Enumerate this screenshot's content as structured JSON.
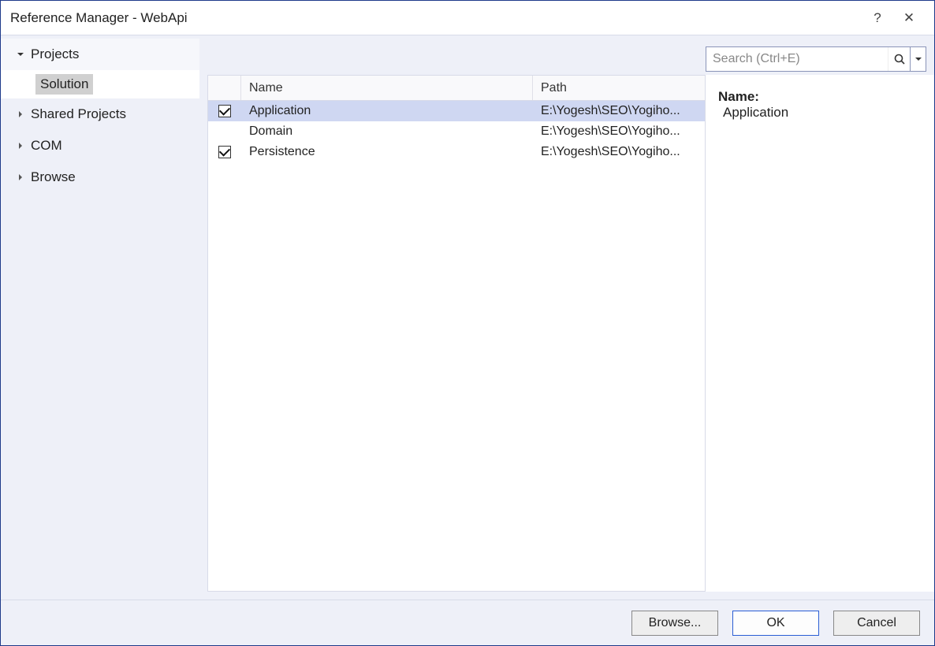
{
  "window": {
    "title": "Reference Manager - WebApi"
  },
  "titlebar_controls": {
    "help": "?",
    "close": "✕"
  },
  "sidebar": {
    "items": [
      {
        "label": "Projects",
        "expanded": true,
        "sub": [
          {
            "label": "Solution",
            "selected": true
          }
        ]
      },
      {
        "label": "Shared Projects",
        "expanded": false
      },
      {
        "label": "COM",
        "expanded": false
      },
      {
        "label": "Browse",
        "expanded": false
      }
    ]
  },
  "search": {
    "placeholder": "Search (Ctrl+E)"
  },
  "list": {
    "columns": {
      "name": "Name",
      "path": "Path"
    },
    "rows": [
      {
        "checked": true,
        "selected": true,
        "name": "Application",
        "path": "E:\\Yogesh\\SEO\\Yogiho..."
      },
      {
        "checked": false,
        "selected": false,
        "name": "Domain",
        "path": "E:\\Yogesh\\SEO\\Yogiho..."
      },
      {
        "checked": true,
        "selected": false,
        "name": "Persistence",
        "path": "E:\\Yogesh\\SEO\\Yogiho..."
      }
    ]
  },
  "detail": {
    "name_label": "Name:",
    "name_value": "Application"
  },
  "footer": {
    "browse": "Browse...",
    "ok": "OK",
    "cancel": "Cancel"
  }
}
